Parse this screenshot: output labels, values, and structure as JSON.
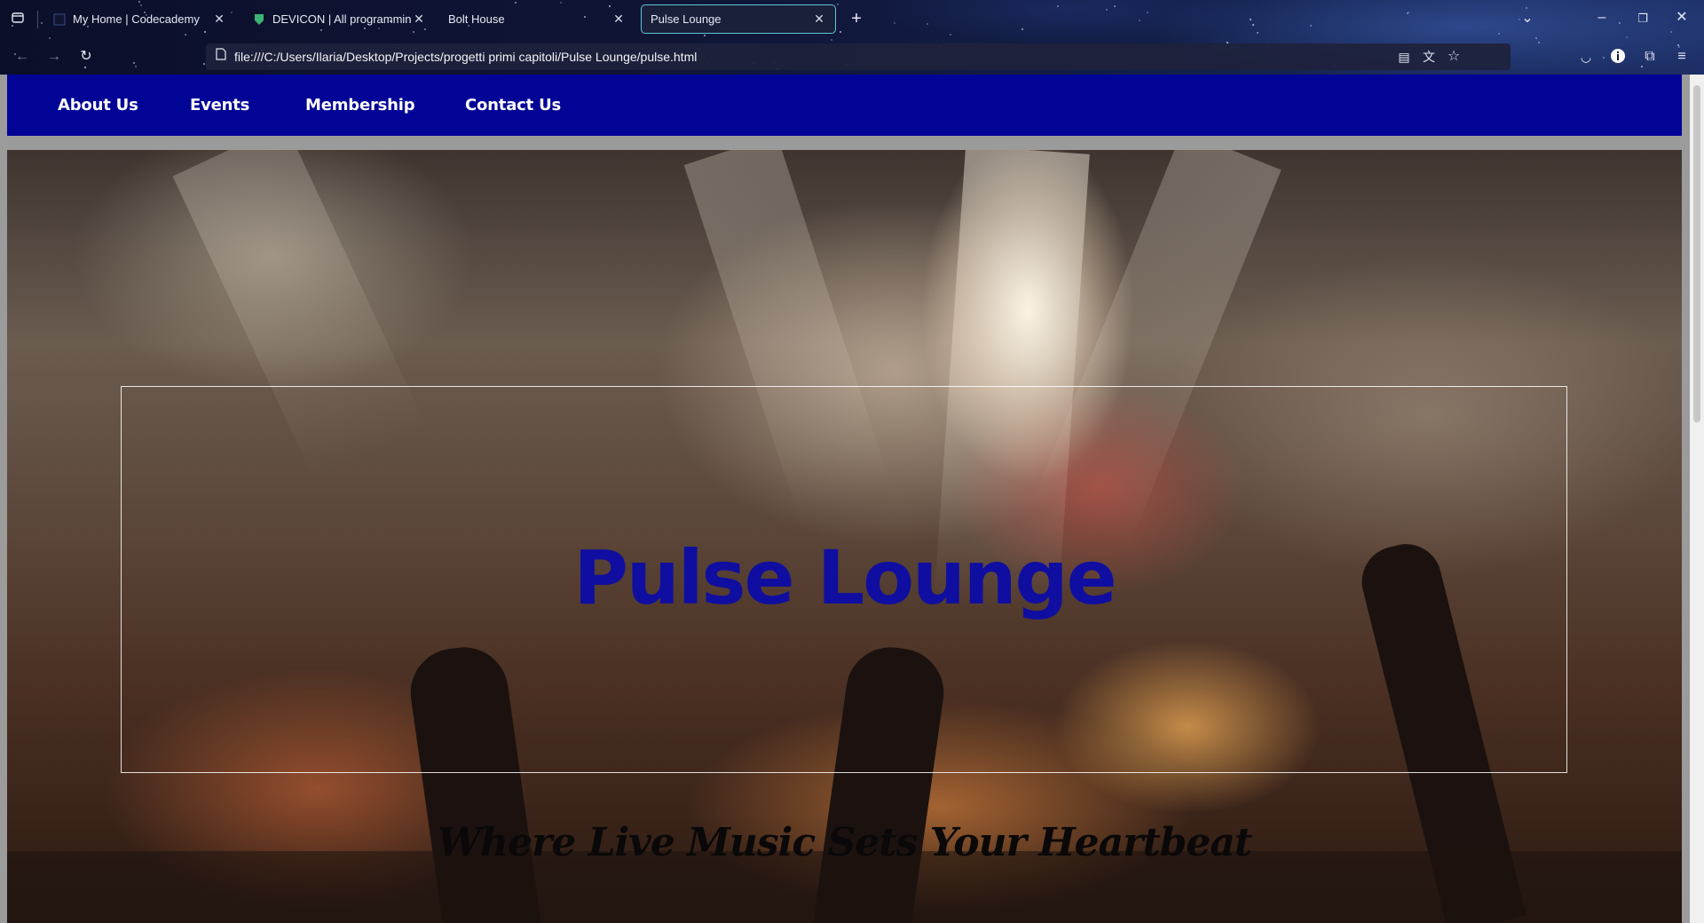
{
  "browser": {
    "tabs": [
      {
        "title": "My Home | Codecademy",
        "active": false
      },
      {
        "title": "DEVICON | All programming la",
        "active": false
      },
      {
        "title": "Bolt House",
        "active": false
      },
      {
        "title": "Pulse Lounge",
        "active": true
      }
    ],
    "url": "file:///C:/Users/Ilaria/Desktop/Projects/progetti primi capitoli/Pulse Lounge/pulse.html",
    "accent_color": "#5cc7d6"
  },
  "nav": {
    "background": "#020496",
    "links": [
      {
        "label": "About Us"
      },
      {
        "label": "Events"
      },
      {
        "label": "Membership"
      },
      {
        "label": "Contact Us"
      }
    ]
  },
  "hero": {
    "title": "Pulse Lounge",
    "title_color": "#0f0ea0",
    "tagline": "Where Live Music Sets Your Heartbeat"
  }
}
